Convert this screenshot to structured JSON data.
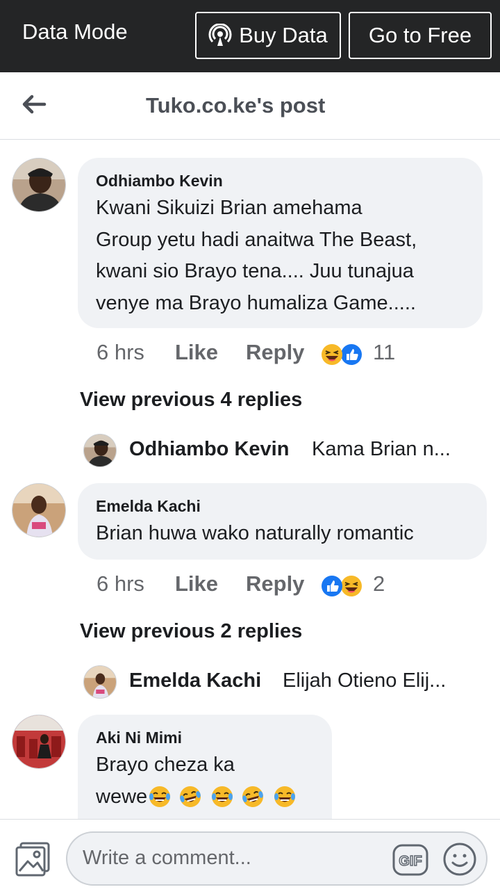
{
  "data_bar": {
    "title": "Data Mode",
    "buy_data_label": "Buy Data",
    "go_free_label": "Go to Free"
  },
  "header": {
    "title": "Tuko.co.ke's post"
  },
  "comments": [
    {
      "author": "Odhiambo Kevin",
      "lines": [
        "Kwani Sikuizi Brian amehama",
        "Group yetu hadi anaitwa The Beast,",
        "kwani sio Brayo tena.... Juu tunajua",
        "venye ma Brayo humaliza Game....."
      ],
      "time": "6 hrs",
      "like_label": "Like",
      "reply_label": "Reply",
      "reaction_count": "11",
      "view_previous": "View previous 4 replies",
      "reply_preview": {
        "author": "Odhiambo Kevin",
        "text": "Kama Brian n..."
      }
    },
    {
      "author": "Emelda Kachi",
      "lines": [
        "Brian huwa wako naturally romantic"
      ],
      "time": "6 hrs",
      "like_label": "Like",
      "reply_label": "Reply",
      "reaction_count": "2",
      "view_previous": "View previous 2 replies",
      "reply_preview": {
        "author": "Emelda Kachi",
        "text": "Elijah Otieno Elij..."
      }
    },
    {
      "author": "Aki Ni Mimi",
      "lines": [
        "Brayo cheza ka",
        "wewe"
      ]
    }
  ],
  "footer": {
    "placeholder": "Write a comment...",
    "gif_label": "GIF"
  },
  "colors": {
    "top_bar": "#242526",
    "bubble": "#f0f2f5",
    "like_blue": "#1877f2",
    "haha_yellow": "#f7b928"
  }
}
